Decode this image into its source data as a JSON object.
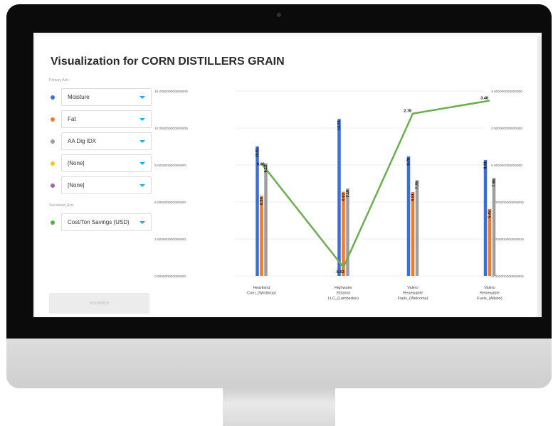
{
  "page": {
    "title": "Visualization for CORN DISTILLERS GRAIN"
  },
  "sidebar": {
    "primary_label": "Primary Axis",
    "secondary_label": "Secondary Axis",
    "primary": [
      {
        "label": "Moisture",
        "color": "#3a6fd8"
      },
      {
        "label": "Fat",
        "color": "#ef7b2a"
      },
      {
        "label": "AA Dig IDX",
        "color": "#9e9e9e"
      },
      {
        "label": "[None]",
        "color": "#f5c518"
      },
      {
        "label": "[None]",
        "color": "#a95fb6"
      }
    ],
    "secondary": [
      {
        "label": "Cost/Ton Savings (USD)",
        "color": "#58b043"
      }
    ],
    "visualize_label": "Visualize"
  },
  "chart_data": {
    "type": "bar",
    "categories": [
      "Heartland Corn_(Winthrop)",
      "Highwater Ethanol LLC_(Lamberton)",
      "Valero Renewable Fuels_(Welcome)",
      "Valero Renewable Fuels_(Albion)"
    ],
    "category_lines": [
      [
        "Heartland",
        "Corn_(Winthrop)"
      ],
      [
        "Highwater",
        "Ethanol",
        "LLC_(Lamberton)"
      ],
      [
        "Valero",
        "Renewable",
        "Fuels_(Welcome)"
      ],
      [
        "Valero",
        "Renewable",
        "Fuels_(Albion)"
      ]
    ],
    "series": [
      {
        "name": "Moisture",
        "axis": "primary",
        "kind": "bar",
        "color": "#3a6fd8",
        "values": [
          10.51,
          12.73,
          9.7,
          9.41
        ],
        "labels": [
          "10.51",
          "12.73",
          "9.70",
          "9.41"
        ]
      },
      {
        "name": "Fat",
        "axis": "primary",
        "kind": "bar",
        "color": "#ef7b2a",
        "values": [
          6.5,
          6.83,
          6.81,
          5.43
        ],
        "labels": [
          "6.50",
          "6.83",
          "6.81",
          "5.43"
        ]
      },
      {
        "name": "AA Dig IDX",
        "axis": "primary",
        "kind": "bar",
        "color": "#9e9e9e",
        "values": [
          9.13,
          7.1,
          7.78,
          7.96
        ],
        "labels": [
          "9.13",
          "7.10",
          "7.78",
          "7.96"
        ]
      },
      {
        "name": "Cost/Ton Savings (USD)",
        "axis": "secondary",
        "kind": "line",
        "color": "#6ab04c",
        "values": [
          0.08,
          -5.53,
          2.78,
          3.48
        ],
        "labels": [
          "0.08",
          "-5.53",
          "2.78",
          "3.48"
        ]
      }
    ],
    "y_primary": {
      "ticks": [
        0,
        3,
        6,
        9,
        12,
        15
      ],
      "tick_labels": [
        "0.000000000000000",
        "3.000000000000000",
        "6.000000000000000",
        "9.000000000000000",
        "12.000000000000000",
        "15.000000000000000"
      ],
      "range": [
        0,
        15
      ]
    },
    "y_secondary": {
      "ticks": [
        -6,
        -4,
        -2,
        0,
        2,
        4
      ],
      "tick_labels": [
        "-6.000000000000000",
        "-4.000000000000000",
        "-2.000000000000000",
        "0.000000000000000",
        "2.000000000000000",
        "4.000000000000000"
      ],
      "range": [
        -6,
        4
      ]
    },
    "grid": true
  }
}
